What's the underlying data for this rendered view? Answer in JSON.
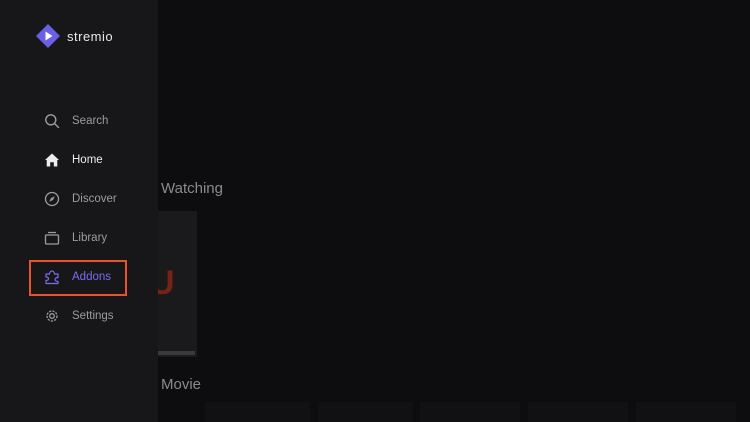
{
  "app": {
    "name": "stremio",
    "accent_color": "#7b6cf0",
    "logo_color": "#6a5fe6"
  },
  "sidebar": {
    "items": [
      {
        "label": "Search",
        "icon": "search-icon"
      },
      {
        "label": "Home",
        "icon": "home-icon",
        "active": true
      },
      {
        "label": "Discover",
        "icon": "compass-icon"
      },
      {
        "label": "Library",
        "icon": "library-icon"
      },
      {
        "label": "Addons",
        "icon": "puzzle-icon",
        "selected": true
      },
      {
        "label": "Settings",
        "icon": "gear-icon"
      }
    ],
    "highlight_color": "#e8532f"
  },
  "main": {
    "rows": [
      {
        "title": "Watching"
      },
      {
        "title": "Movie"
      }
    ],
    "poster_letter": "U"
  }
}
